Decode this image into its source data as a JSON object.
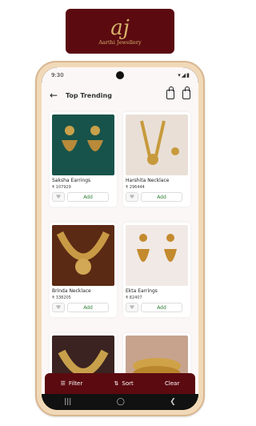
{
  "brand": {
    "logo_mark": "aj",
    "logo_text": "Aarthi Jewellery"
  },
  "status": {
    "time": "9:30",
    "icons": "▾◢▮"
  },
  "appbar": {
    "title": "Top Trending"
  },
  "products": [
    {
      "name": "Saksha Earrings",
      "price": "₹ 107929",
      "add": "Add",
      "img_bg": "#17534a"
    },
    {
      "name": "Harshita Necklace",
      "price": "₹ 296444",
      "add": "Add",
      "img_bg": "#e9dfd6"
    },
    {
      "name": "Brinda Necklace",
      "price": "₹ 338205",
      "add": "Add",
      "img_bg": "#5b2a14"
    },
    {
      "name": "Ekta Earrings",
      "price": "₹ 82407",
      "add": "Add",
      "img_bg": "#f1e9e5"
    },
    {
      "name": "",
      "price": "",
      "add": "",
      "img_bg": "#3a2320"
    },
    {
      "name": "",
      "price": "",
      "add": "",
      "img_bg": "#c7a38e"
    }
  ],
  "bottom_bar": {
    "filter": "Filter",
    "sort": "Sort",
    "clear": "Clear"
  },
  "nav": {
    "menu": "|||",
    "home": "◯",
    "back": "❮"
  }
}
